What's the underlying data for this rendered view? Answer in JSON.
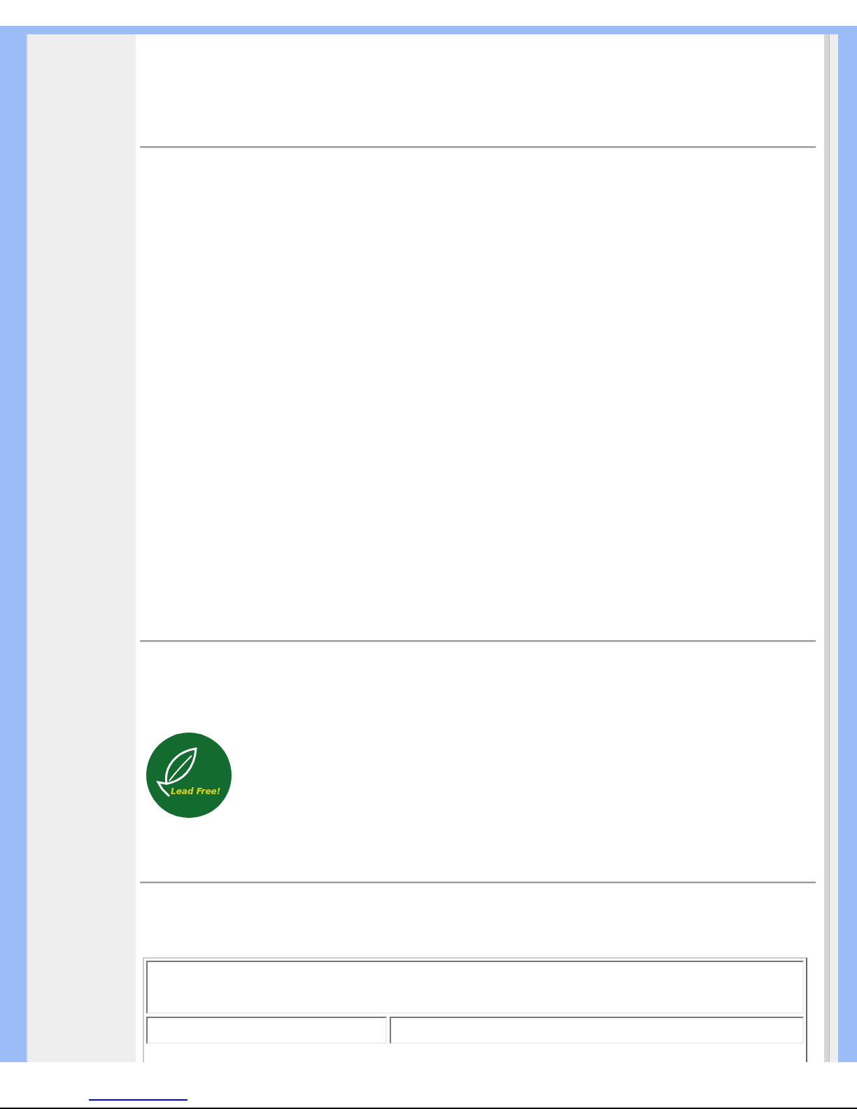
{
  "badge": {
    "text": "Lead Free!"
  }
}
